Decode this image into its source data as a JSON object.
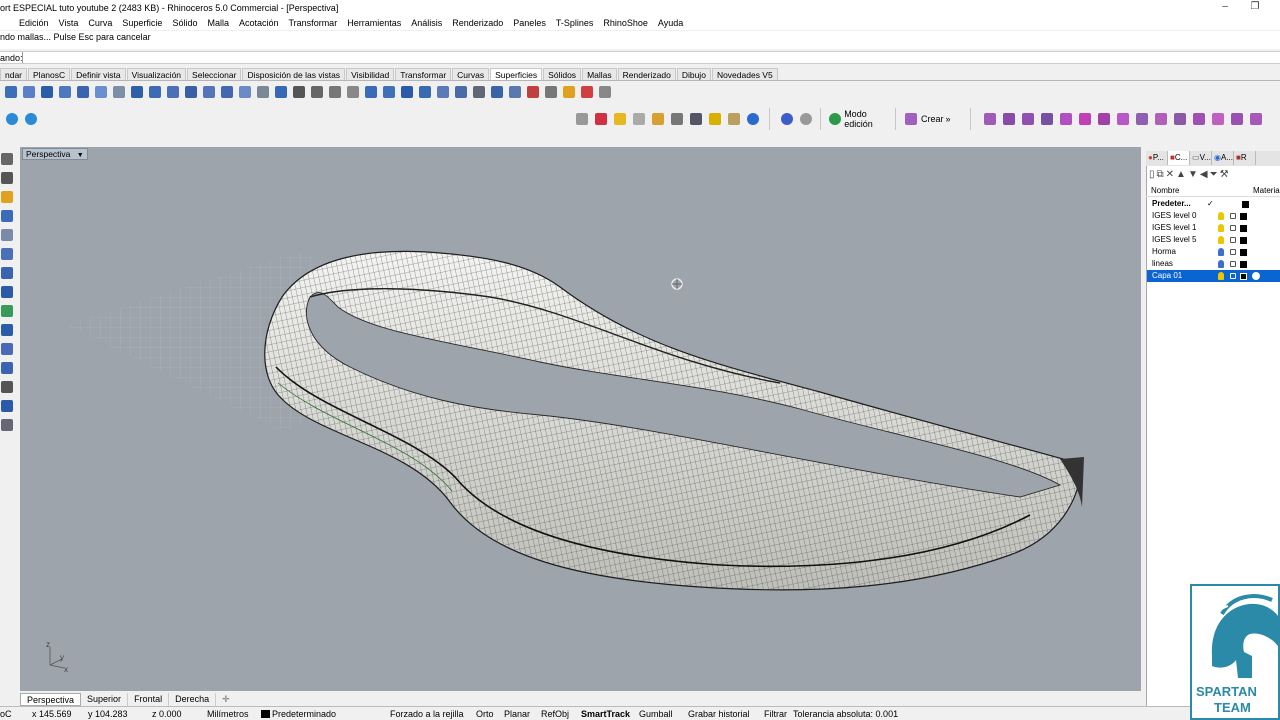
{
  "window": {
    "title": "ort ESPECIAL  tuto youtube 2 (2483 KB) - Rhinoceros 5.0 Commercial - [Perspectiva]"
  },
  "menu": [
    "Edición",
    "Vista",
    "Curva",
    "Superficie",
    "Sólido",
    "Malla",
    "Acotación",
    "Transformar",
    "Herramientas",
    "Análisis",
    "Renderizado",
    "Paneles",
    "T-Splines",
    "RhinoShoe",
    "Ayuda"
  ],
  "command": {
    "history": "ndo mallas... Pulse Esc para cancelar",
    "prompt": "ando:"
  },
  "tabs": {
    "items": [
      "ndar",
      "PlanosC",
      "Definir vista",
      "Visualización",
      "Seleccionar",
      "Disposición de las vistas",
      "Visibilidad",
      "Transformar",
      "Curvas",
      "Superficies",
      "Sólidos",
      "Mallas",
      "Renderizado",
      "Dibujo",
      "Novedades V5"
    ],
    "active": "Superficies"
  },
  "toolbar2": {
    "modo_edicion": "Modo edición",
    "crear": "Crear",
    "more": "»"
  },
  "viewport": {
    "label": "Perspectiva",
    "axes": {
      "z": "z",
      "y": "y",
      "x": "x"
    }
  },
  "viewport_tabs": [
    "Perspectiva",
    "Superior",
    "Frontal",
    "Derecha"
  ],
  "status": {
    "cplane": "oC",
    "x": "x 145.569",
    "y": "y 104.283",
    "z": "z 0.000",
    "units": "Milímetros",
    "layer": "Predeterminado",
    "items": [
      "Forzado a la rejilla",
      "Orto",
      "Planar",
      "RefObj",
      "SmartTrack",
      "Gumball",
      "Grabar historial",
      "Filtrar"
    ],
    "tolerance": "Tolerancia absoluta: 0.001"
  },
  "panel": {
    "tabs": [
      "P...",
      "C...",
      "V...",
      "A...",
      "R"
    ],
    "columns": {
      "name": "Nombre",
      "material": "Material"
    },
    "layers": [
      {
        "name": "Predeter...",
        "current": true,
        "bulb": "#e8c800"
      },
      {
        "name": "IGES level 0",
        "bulb": "#e8c800"
      },
      {
        "name": "IGES level 1",
        "bulb": "#e8c800"
      },
      {
        "name": "IGES level 5",
        "bulb": "#e8c800"
      },
      {
        "name": "Horma",
        "bulb": "#3a6fd0"
      },
      {
        "name": "lineas",
        "bulb": "#3a6fd0"
      },
      {
        "name": "Capa 01",
        "bulb": "#e8c800",
        "selected": true
      }
    ]
  },
  "logo": {
    "text": "SPARTAN TEAM"
  }
}
